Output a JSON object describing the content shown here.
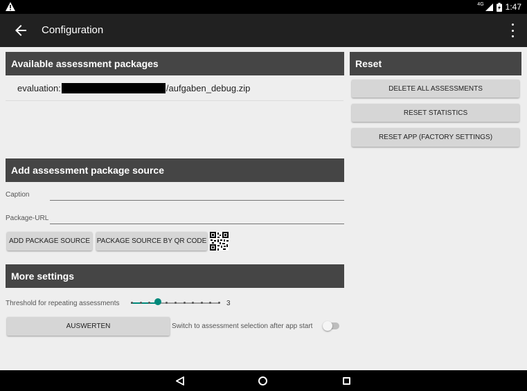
{
  "status_bar": {
    "network": "4G",
    "time": "1:47"
  },
  "app_bar": {
    "title": "Configuration"
  },
  "packages": {
    "header": "Available assessment packages",
    "items": [
      {
        "prefix": "evaluation:",
        "suffix": "/aufgaben_debug.zip"
      }
    ]
  },
  "add_source": {
    "header": "Add assessment package source",
    "caption_label": "Caption",
    "caption_value": "",
    "url_label": "Package-URL",
    "url_value": "",
    "add_button": "ADD PACKAGE SOURCE",
    "qr_button": "PACKAGE SOURCE BY QR CODE"
  },
  "more_settings": {
    "header": "More settings",
    "threshold_label": "Threshold for repeating assessments",
    "threshold_value": "3",
    "threshold": {
      "value": 3,
      "min": 0,
      "max": 10
    },
    "evaluate_button": "AUSWERTEN",
    "switch_label": "Switch to assessment selection after app start",
    "switch_on": false
  },
  "reset": {
    "header": "Reset",
    "delete_button": "DELETE ALL ASSESSMENTS",
    "stats_button": "RESET STATISTICS",
    "factory_button": "RESET APP (FACTORY SETTINGS)"
  },
  "colors": {
    "accent": "#00897b",
    "section_header": "#454545",
    "app_bar": "#212121",
    "background": "#eeeeee"
  }
}
